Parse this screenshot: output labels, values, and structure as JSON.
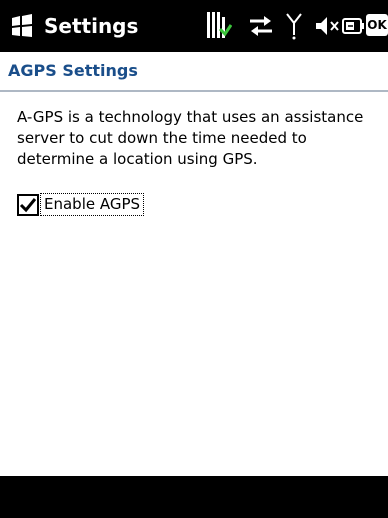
{
  "window": {
    "title": "Settings",
    "ok_label": "OK"
  },
  "status_bar": {
    "icons": [
      "start-flag-icon",
      "sim-card-icon",
      "data-sync-icon",
      "signal-icon",
      "volume-muted-icon",
      "battery-icon"
    ]
  },
  "page": {
    "title": "AGPS Settings",
    "description": "A-GPS is a technology that uses an assistance server to cut down the time needed to determine a location using GPS."
  },
  "options": {
    "enable_agps": {
      "label": "Enable AGPS",
      "checked": true
    }
  },
  "colors": {
    "title_bar": "#000000",
    "header_text": "#1a4e8a",
    "header_divider": "#aeb8c4",
    "status_green": "#3cc43c"
  }
}
